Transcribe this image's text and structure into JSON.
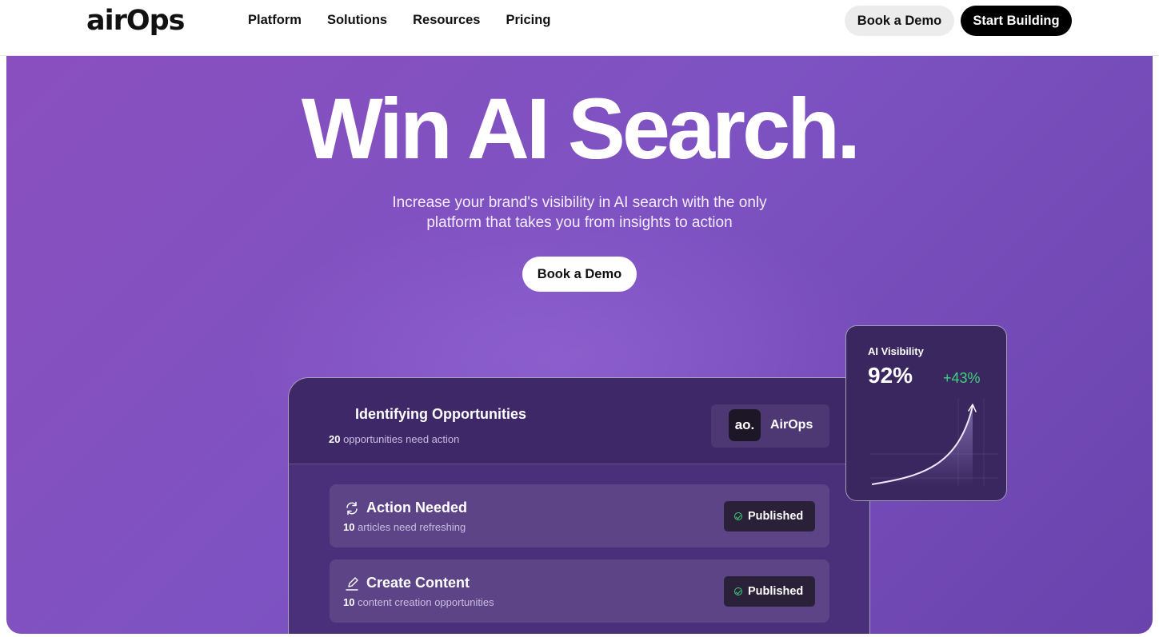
{
  "nav": {
    "logo": "airOps",
    "links": [
      "Platform",
      "Solutions",
      "Resources",
      "Pricing"
    ],
    "book_demo": "Book a Demo",
    "start_building": "Start Building"
  },
  "hero": {
    "headline": "Win AI Search.",
    "subline_1": "Increase your brand's visibility in AI search with the only",
    "subline_2": "platform that takes you from insights to action",
    "cta": "Book a Demo"
  },
  "card": {
    "title": "Identifying Opportunities",
    "count": "20",
    "count_text": " opportunities need action",
    "brand_logo": "ao.",
    "brand_name": "AirOps",
    "rows": [
      {
        "icon": "refresh-icon",
        "title": "Action Needed",
        "count": "10",
        "text": " articles need refreshing",
        "status": "Published"
      },
      {
        "icon": "pencil-icon",
        "title": "Create Content",
        "count": "10",
        "text": " content creation opportunities",
        "status": "Published"
      }
    ]
  },
  "visibility": {
    "label": "AI Visibility",
    "value": "92%",
    "delta": "+43%"
  },
  "colors": {
    "hero_purple": "#7e52c2",
    "card_bg": "#4a2f7a",
    "positive_green": "#3ed37c",
    "black": "#000000"
  }
}
